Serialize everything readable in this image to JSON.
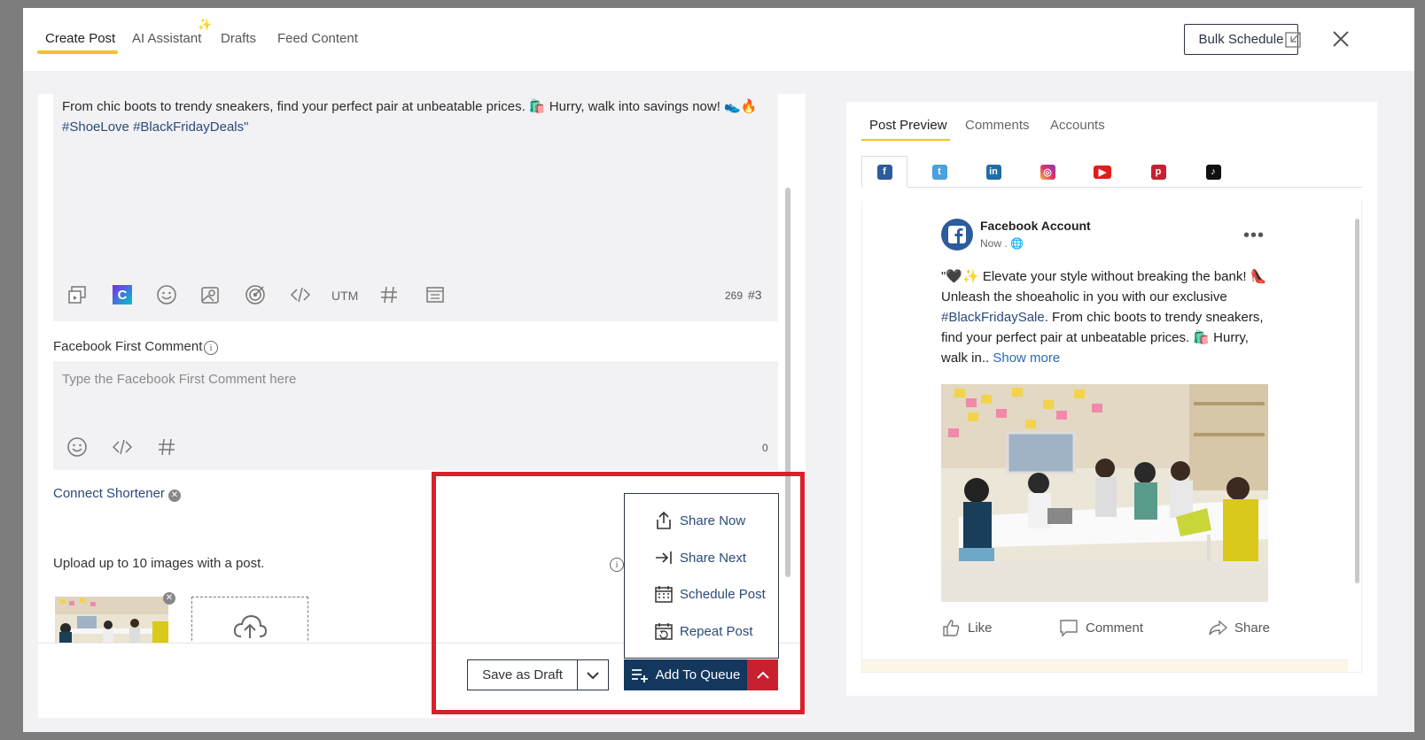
{
  "topbar": {
    "tabs": [
      {
        "label": "Create Post"
      },
      {
        "label": "AI Assistant"
      },
      {
        "label": "Drafts"
      },
      {
        "label": "Feed Content"
      }
    ],
    "sparkle": "✨",
    "bulk_schedule": "Bulk Schedule"
  },
  "editor": {
    "text": "From chic boots to trendy sneakers, find your perfect pair at unbeatable prices. 🛍️ Hurry, walk into savings now! 👟🔥",
    "hashtags": "#ShoeLove #BlackFridayDeals\"",
    "utm_label": "UTM",
    "char_count": "269",
    "hashtag_count": "#3",
    "tools": [
      "media-icon",
      "canva-icon",
      "emoji-icon",
      "image-library-icon",
      "target-icon",
      "code-icon",
      "utm",
      "hashtag-icon",
      "template-icon"
    ]
  },
  "first_comment": {
    "label": "Facebook First Comment",
    "placeholder": "Type the Facebook First Comment here",
    "count": "0"
  },
  "shortener": {
    "label": "Connect Shortener"
  },
  "upload": {
    "text": "Upload up to 10 images with a post."
  },
  "dropdown": {
    "items": [
      {
        "label": "Share Now",
        "icon": "share-now-icon"
      },
      {
        "label": "Share Next",
        "icon": "share-next-icon"
      },
      {
        "label": "Schedule Post",
        "icon": "calendar-icon"
      },
      {
        "label": "Repeat Post",
        "icon": "repeat-calendar-icon"
      }
    ]
  },
  "footer": {
    "save_draft": "Save as Draft",
    "add_queue": "Add To Queue"
  },
  "preview": {
    "tabs": [
      {
        "label": "Post Preview"
      },
      {
        "label": "Comments"
      },
      {
        "label": "Accounts"
      }
    ],
    "socials": [
      "facebook",
      "twitter",
      "linkedin",
      "instagram",
      "youtube",
      "pinterest",
      "tiktok"
    ],
    "account_name": "Facebook Account",
    "time": "Now .",
    "post_line1": "\"🖤✨ Elevate your style without breaking the bank! 👠",
    "post_line2": "Unleash the shoeaholic in you with our exclusive",
    "post_link": "#BlackFridaySale",
    "post_line3": ". From chic boots to trendy sneakers,",
    "post_line4": "find your perfect pair at unbeatable prices. 🛍️ Hurry,",
    "post_line5": "walk in..",
    "show_more": "Show more",
    "like": "Like",
    "comment": "Comment",
    "share": "Share"
  },
  "colors": {
    "accent_yellow": "#f2c12e",
    "navy": "#14375e",
    "red": "#c8202f",
    "highlight": "#d9202b"
  }
}
